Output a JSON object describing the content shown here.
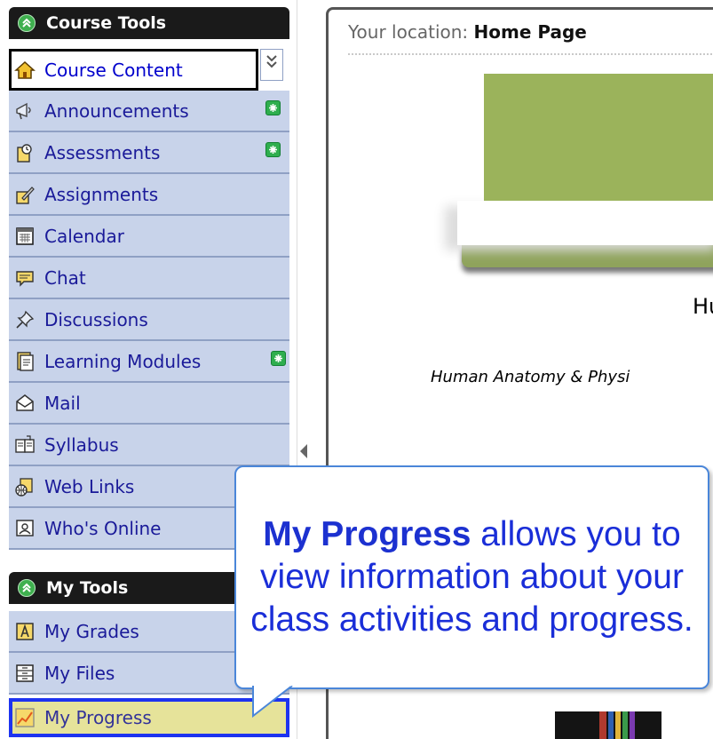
{
  "sidebar": {
    "course_tools": {
      "title": "Course Tools",
      "items": [
        {
          "label": "Course Content",
          "icon": "home-icon",
          "current": true
        },
        {
          "label": "Announcements",
          "icon": "megaphone-icon",
          "new": true
        },
        {
          "label": "Assessments",
          "icon": "assessment-icon",
          "new": true
        },
        {
          "label": "Assignments",
          "icon": "assignment-icon"
        },
        {
          "label": "Calendar",
          "icon": "calendar-icon"
        },
        {
          "label": "Chat",
          "icon": "chat-icon"
        },
        {
          "label": "Discussions",
          "icon": "pushpin-icon"
        },
        {
          "label": "Learning Modules",
          "icon": "document-icon",
          "new": true
        },
        {
          "label": "Mail",
          "icon": "mail-icon"
        },
        {
          "label": "Syllabus",
          "icon": "syllabus-icon"
        },
        {
          "label": "Web Links",
          "icon": "globe-icon"
        },
        {
          "label": "Who's Online",
          "icon": "user-icon"
        }
      ]
    },
    "my_tools": {
      "title": "My Tools",
      "items": [
        {
          "label": "My Grades",
          "icon": "grades-icon"
        },
        {
          "label": "My Files",
          "icon": "files-icon"
        },
        {
          "label": "My Progress",
          "icon": "progress-chart-icon",
          "highlighted": true
        }
      ]
    }
  },
  "main": {
    "location_label": "Your location:",
    "location_value": "Home Page",
    "course_title_partial": "Hu",
    "course_subtitle_partial": "Human Anatomy & Physi"
  },
  "callout": {
    "keyword": "My Progress",
    "text": " allows you to view information about your class activities and progress."
  },
  "colors": {
    "sidebar_item_bg": "#c8d3ea",
    "header_bg": "#1a1a1a",
    "banner_green": "#9bb35b",
    "callout_text": "#1a2ed8",
    "highlight_border": "#1d33f0"
  }
}
